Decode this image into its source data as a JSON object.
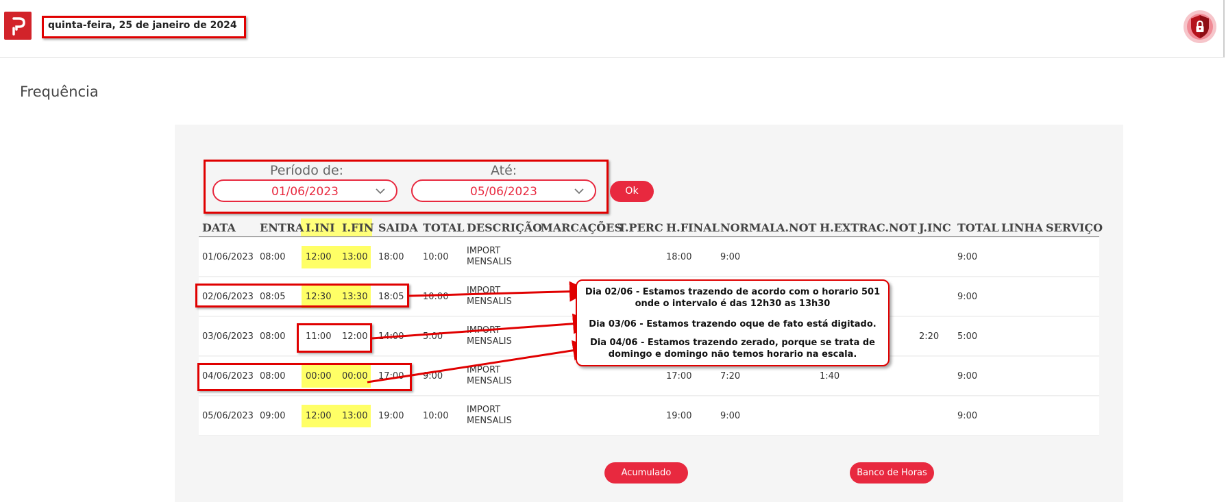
{
  "header": {
    "logo_glyph": "P",
    "date": "quinta-feira, 25 de janeiro de 2024",
    "shield_icon": "shield-lock-icon"
  },
  "page_title": "Frequência",
  "filter": {
    "from_label": "Período de:",
    "from_value": "01/06/2023",
    "to_label": "Até:",
    "to_value": "05/06/2023",
    "ok_label": "Ok"
  },
  "table": {
    "headers": [
      "DATA",
      "ENTRA",
      "I.INI",
      "I.FIN",
      "SAIDA",
      "TOTAL",
      "DESCRIÇÃO",
      "MARCAÇÕES",
      "T.PERC",
      "H.FINAL",
      "NORMAL",
      "A.NOT",
      "H.EXTRA",
      "C.NOT",
      "J.INC",
      "TOTAL",
      "LINHA",
      "SERVIÇO"
    ],
    "rows": [
      {
        "data": "01/06/2023",
        "entra": "08:00",
        "iini": "12:00",
        "ifin": "13:00",
        "saida": "18:00",
        "total": "10:00",
        "desc1": "IMPORT",
        "desc2": "MENSALIS",
        "hfinal": "18:00",
        "normal": "9:00",
        "anot": "",
        "hextra": "",
        "cnot": "",
        "jinc": "",
        "total2": "9:00"
      },
      {
        "data": "02/06/2023",
        "entra": "08:05",
        "iini": "12:30",
        "ifin": "13:30",
        "saida": "18:05",
        "total": "10:00",
        "desc1": "IMPORT",
        "desc2": "MENSALIS",
        "hfinal": "",
        "normal": "",
        "anot": "",
        "hextra": "",
        "cnot": "",
        "jinc": "",
        "total2": "9:00"
      },
      {
        "data": "03/06/2023",
        "entra": "08:00",
        "iini": "11:00",
        "ifin": "12:00",
        "saida": "14:00",
        "total": "5:00",
        "desc1": "IMPORT",
        "desc2": "MENSALIS",
        "hfinal": "",
        "normal": "",
        "anot": "",
        "hextra": "",
        "cnot": "",
        "jinc": "2:20",
        "total2": "5:00"
      },
      {
        "data": "04/06/2023",
        "entra": "08:00",
        "iini": "00:00",
        "ifin": "00:00",
        "saida": "17:00",
        "total": "9:00",
        "desc1": "IMPORT",
        "desc2": "MENSALIS",
        "hfinal": "17:00",
        "normal": "7:20",
        "anot": "",
        "hextra": "1:40",
        "cnot": "",
        "jinc": "",
        "total2": "9:00"
      },
      {
        "data": "05/06/2023",
        "entra": "09:00",
        "iini": "12:00",
        "ifin": "13:00",
        "saida": "19:00",
        "total": "10:00",
        "desc1": "IMPORT",
        "desc2": "MENSALIS",
        "hfinal": "19:00",
        "normal": "9:00",
        "anot": "",
        "hextra": "",
        "cnot": "",
        "jinc": "",
        "total2": "9:00"
      }
    ]
  },
  "callout": {
    "note1_line1": "Dia 02/06 - Estamos trazendo de acordo com o horario 501",
    "note1_line2": "onde o intervalo é das 12h30 as 13h30",
    "note2": "Dia 03/06 - Estamos trazendo oque de fato está digitado.",
    "note3_line1": "Dia 04/06 - Estamos trazendo zerado, porque se trata de",
    "note3_line2": "domingo e domingo não temos horario na escala."
  },
  "buttons": {
    "acumulado": "Acumulado",
    "banco_horas": "Banco de Horas"
  },
  "colors": {
    "brand_red": "#d2232a",
    "accent": "#e8293f",
    "highlight": "#ffff66",
    "annotation_red": "#e00000"
  }
}
